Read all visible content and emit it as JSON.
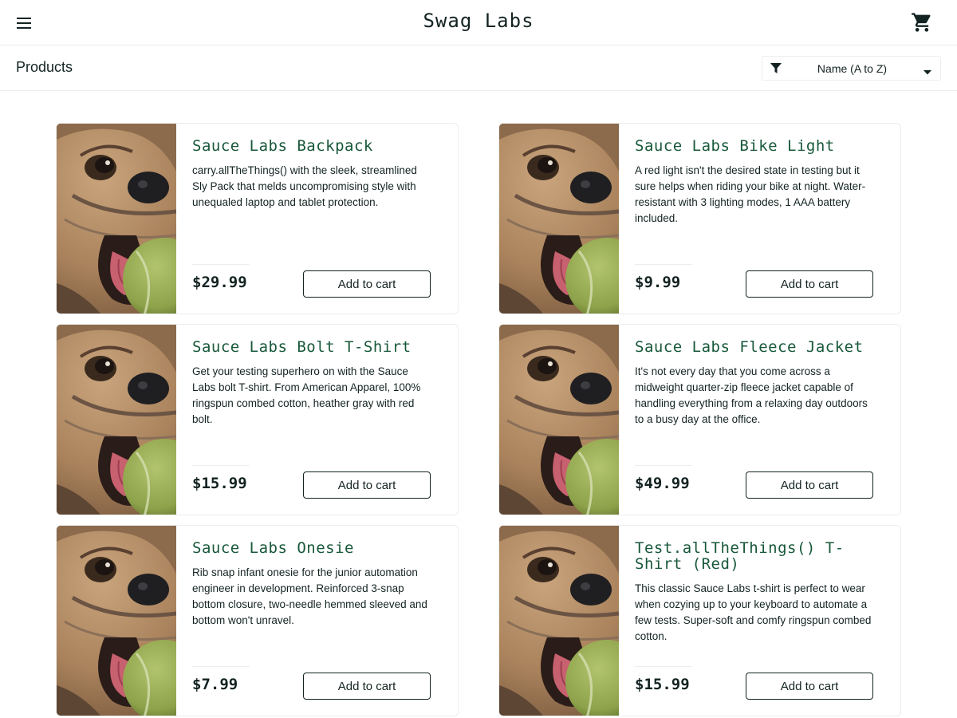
{
  "header": {
    "app_title": "Swag Labs",
    "menu_icon": "hamburger-menu-icon",
    "cart_icon": "shopping-cart-icon"
  },
  "subheader": {
    "title": "Products",
    "sort": {
      "selected": "Name (A to Z)",
      "filter_icon": "filter-icon",
      "caret_icon": "caret-down-icon"
    }
  },
  "colors": {
    "text": "#132322",
    "item_name": "#18583a",
    "border": "#ededed"
  },
  "products": [
    {
      "name": "Sauce Labs Backpack",
      "description": "carry.allTheThings() with the sleek, streamlined Sly Pack that melds uncompromising style with unequaled laptop and tablet protection.",
      "price": "$29.99",
      "button": "Add to cart"
    },
    {
      "name": "Sauce Labs Bike Light",
      "description": "A red light isn't the desired state in testing but it sure helps when riding your bike at night. Water-resistant with 3 lighting modes, 1 AAA battery included.",
      "price": "$9.99",
      "button": "Add to cart"
    },
    {
      "name": "Sauce Labs Bolt T-Shirt",
      "description": "Get your testing superhero on with the Sauce Labs bolt T-shirt. From American Apparel, 100% ringspun combed cotton, heather gray with red bolt.",
      "price": "$15.99",
      "button": "Add to cart"
    },
    {
      "name": "Sauce Labs Fleece Jacket",
      "description": "It's not every day that you come across a midweight quarter-zip fleece jacket capable of handling everything from a relaxing day outdoors to a busy day at the office.",
      "price": "$49.99",
      "button": "Add to cart"
    },
    {
      "name": "Sauce Labs Onesie",
      "description": "Rib snap infant onesie for the junior automation engineer in development. Reinforced 3-snap bottom closure, two-needle hemmed sleeved and bottom won't unravel.",
      "price": "$7.99",
      "button": "Add to cart"
    },
    {
      "name": "Test.allTheThings() T-Shirt (Red)",
      "description": "This classic Sauce Labs t-shirt is perfect to wear when cozying up to your keyboard to automate a few tests. Super-soft and comfy ringspun combed cotton.",
      "price": "$15.99",
      "button": "Add to cart"
    }
  ]
}
